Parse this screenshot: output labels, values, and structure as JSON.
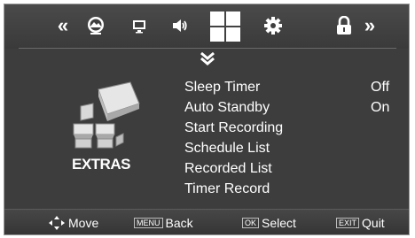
{
  "top_menu": {
    "prev_arrow": "«",
    "next_arrow": "»",
    "icons": [
      "picture-icon",
      "screen-icon",
      "sound-icon",
      "extras-grid-icon",
      "settings-gear-icon",
      "lock-icon"
    ],
    "selected": "extras-grid-icon"
  },
  "submenu": {
    "title": "EXTRAS",
    "items": [
      {
        "label": "Sleep Timer",
        "value": "Off"
      },
      {
        "label": "Auto Standby",
        "value": "On"
      },
      {
        "label": "Start Recording",
        "value": ""
      },
      {
        "label": "Schedule List",
        "value": ""
      },
      {
        "label": "Recorded List",
        "value": ""
      },
      {
        "label": "Timer Record",
        "value": ""
      }
    ]
  },
  "bottom_hints": {
    "move": {
      "label": "Move"
    },
    "back": {
      "key": "MENU",
      "label": "Back"
    },
    "select": {
      "key": "OK",
      "label": "Select"
    },
    "quit": {
      "key": "EXIT",
      "label": "Quit"
    }
  },
  "colors": {
    "background": "#3d3d3d",
    "text": "#ffffff"
  }
}
